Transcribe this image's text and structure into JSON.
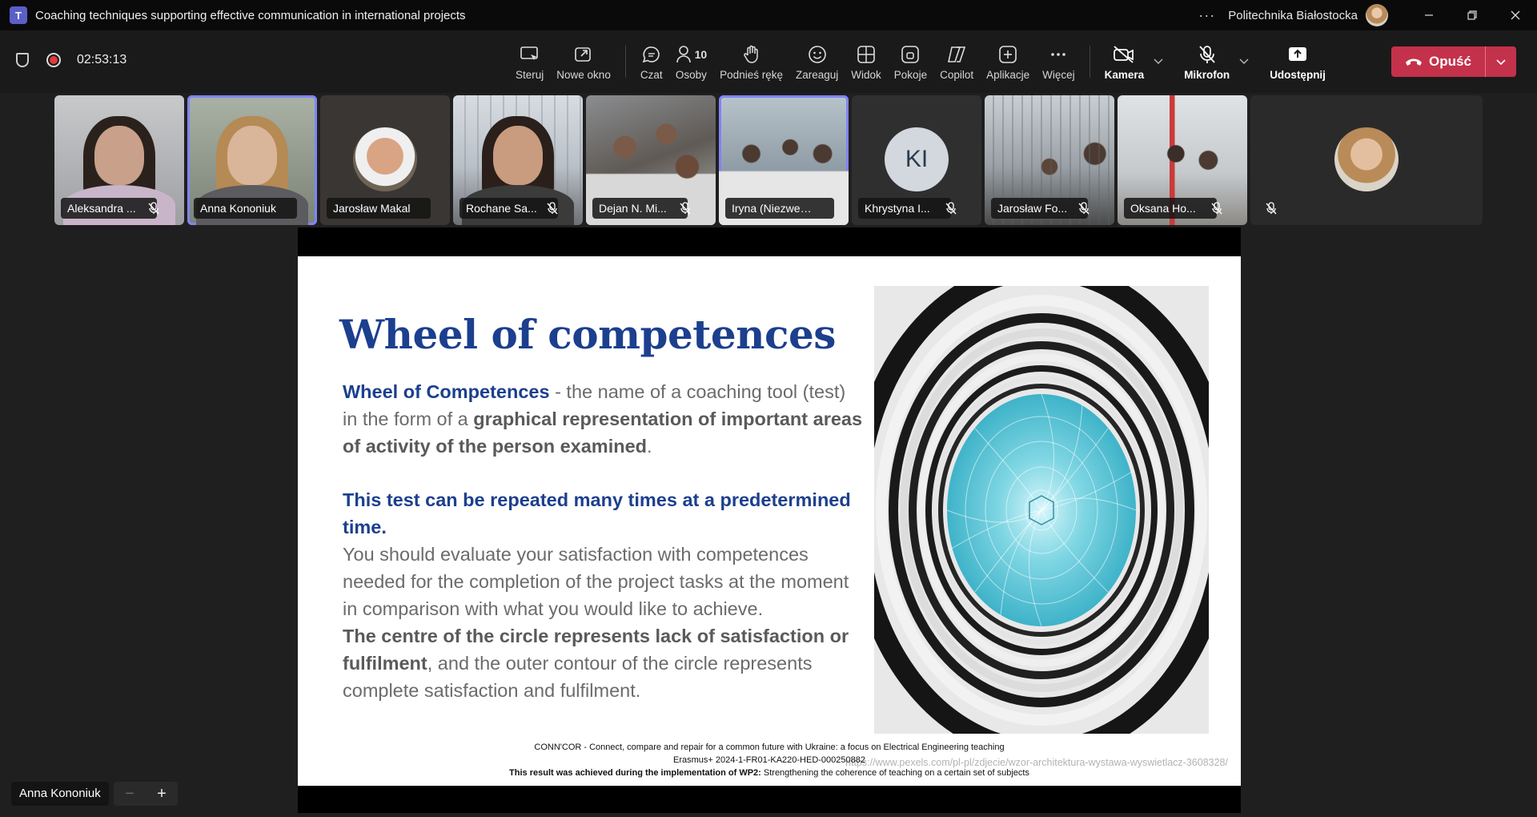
{
  "window": {
    "title": "Coaching techniques supporting effective communication in international projects",
    "org": "Politechnika Białostocka",
    "more_label": "···"
  },
  "meeting": {
    "timer": "02:53:13",
    "people_count": "10"
  },
  "toolbar": {
    "tools": [
      {
        "label": "Steruj",
        "icon": "control-icon"
      },
      {
        "label": "Nowe okno",
        "icon": "new-window-icon"
      },
      {
        "label": "Czat",
        "icon": "chat-icon"
      },
      {
        "label": "Osoby",
        "icon": "people-icon"
      },
      {
        "label": "Podnieś rękę",
        "icon": "raise-hand-icon"
      },
      {
        "label": "Zareaguj",
        "icon": "react-icon"
      },
      {
        "label": "Widok",
        "icon": "view-icon"
      },
      {
        "label": "Pokoje",
        "icon": "rooms-icon"
      },
      {
        "label": "Copilot",
        "icon": "copilot-icon"
      },
      {
        "label": "Aplikacje",
        "icon": "apps-icon"
      },
      {
        "label": "Więcej",
        "icon": "more-icon"
      }
    ],
    "camera_label": "Kamera",
    "mic_label": "Mikrofon",
    "share_label": "Udostępnij",
    "leave_label": "Opuść"
  },
  "participants": [
    {
      "name": "Aleksandra ...",
      "muted": true
    },
    {
      "name": "Anna Kononiuk",
      "muted": false,
      "active": true
    },
    {
      "name": "Jarosław Makal",
      "muted": false
    },
    {
      "name": "Rochane Sa...",
      "muted": true
    },
    {
      "name": "Dejan N. Mi...",
      "muted": true
    },
    {
      "name": "Iryna (Niezweryf...",
      "muted": false,
      "active": true
    },
    {
      "name": "Khrystyna I...",
      "muted": true,
      "initials": "KI"
    },
    {
      "name": "Jarosław Fo...",
      "muted": true
    },
    {
      "name": "Oksana Ho...",
      "muted": true
    },
    {
      "name": "",
      "muted": true
    }
  ],
  "slide": {
    "title": "Wheel of competences",
    "p1_bold": "Wheel of Competences",
    "p1_a": " - the name of a coaching tool (test) in the form of a ",
    "p1_b": "graphical representation of important areas of activity of the person examined",
    "p1_c": ".",
    "p2": "This test can be repeated many times at a predetermined time.",
    "p3": "You should evaluate your satisfaction with competences needed for the completion of the project tasks at the moment in comparison with what you would like to achieve.",
    "p4_bold": "The centre of the circle represents lack of satisfaction or fulfilment",
    "p4_rest": ", and the outer contour of the circle represents complete satisfaction and fulfilment.",
    "footer1": "CONN'COR - Connect, compare and repair for a common future with Ukraine: a focus on Electrical Engineering teaching",
    "footer2": "Erasmus+ 2024-1-FR01-KA220-HED-000250882",
    "footer3_bold": "This result was achieved during the implementation of WP2:",
    "footer3_rest": " Strengthening the coherence of teaching on a certain set of subjects",
    "credit": "https://www.pexels.com/pl-pl/zdjecie/wzor-architektura-wystawa-wyswietlacz-3608328/"
  },
  "presenter": {
    "name": "Anna Kononiuk",
    "zoom_out": "−",
    "zoom_in": "+"
  }
}
